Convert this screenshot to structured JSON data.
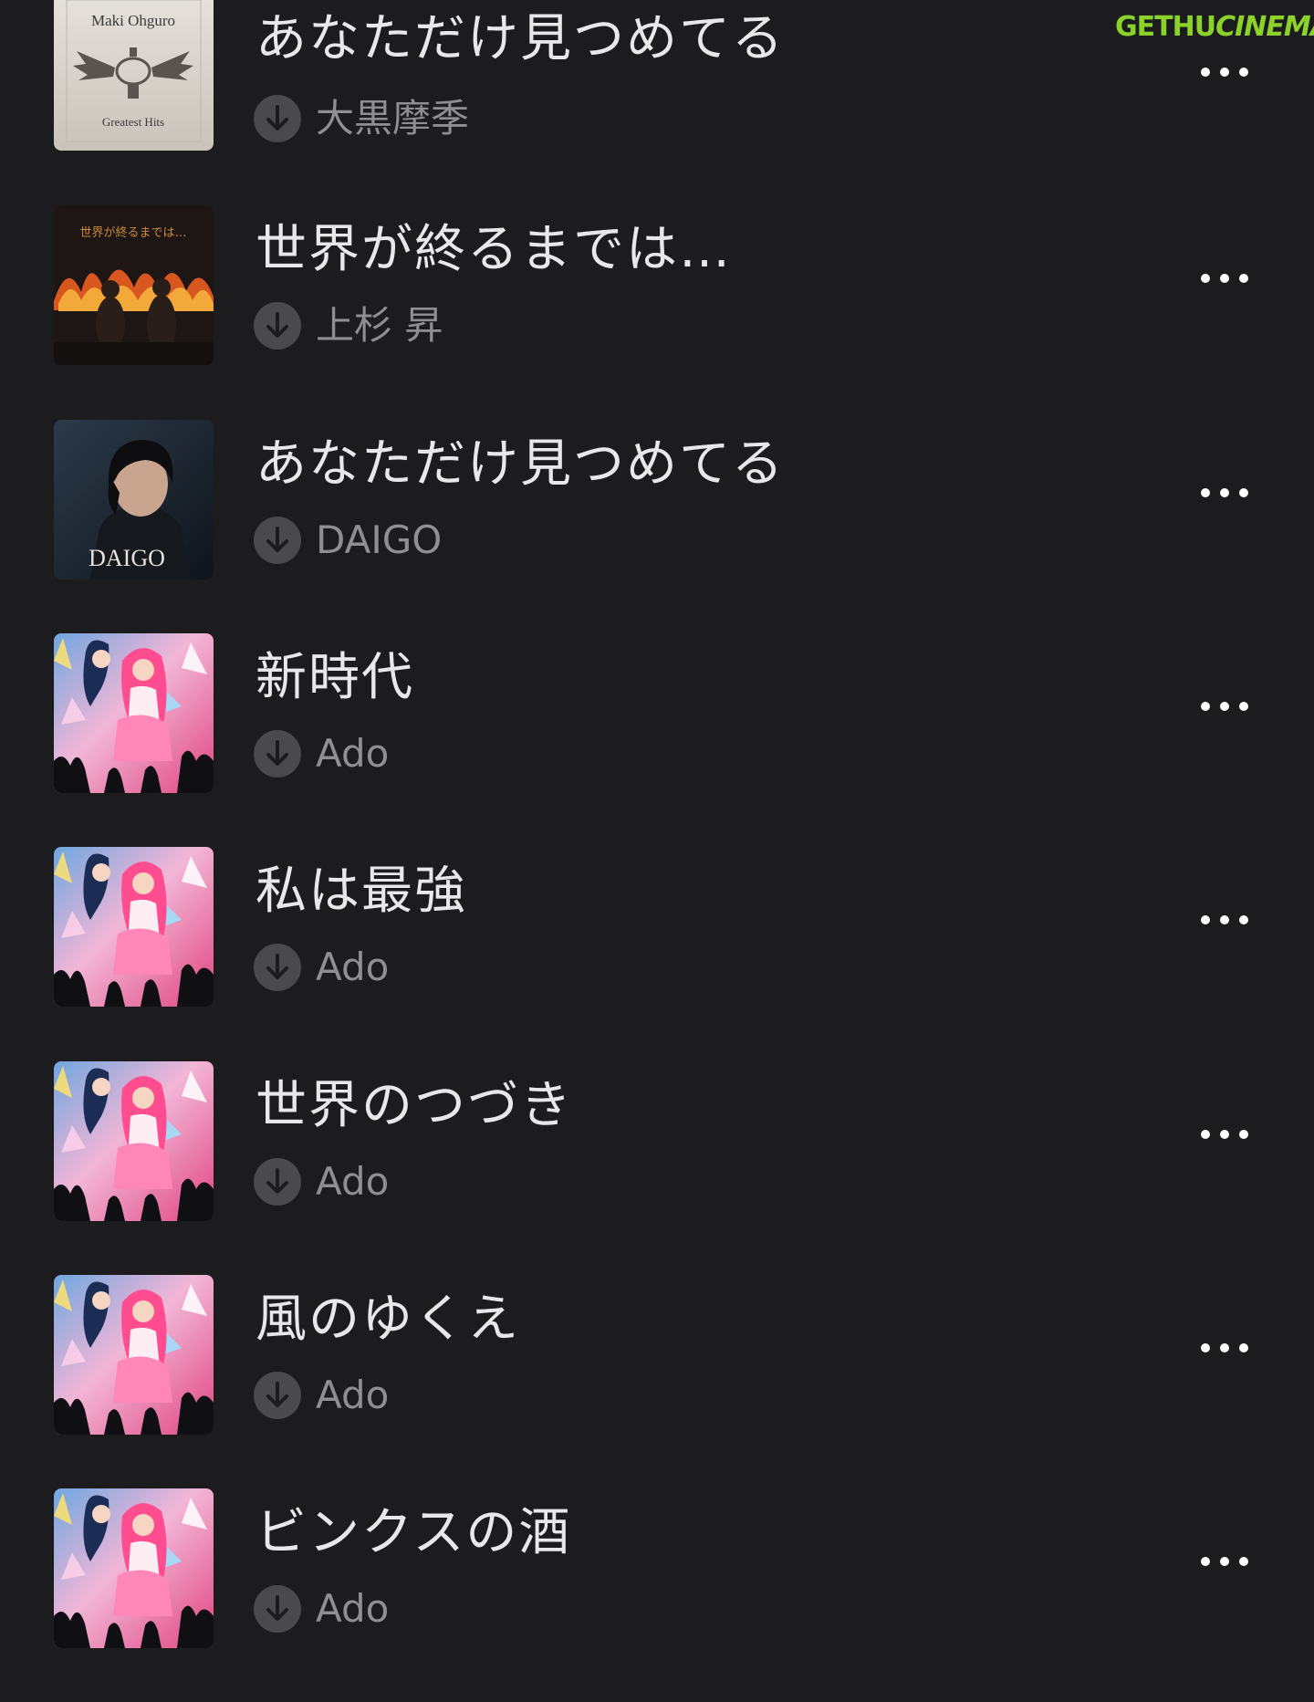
{
  "watermark": {
    "part1": "GETHU",
    "part2": "CINEMA"
  },
  "songs": [
    {
      "title": "あなただけ見つめてる",
      "artist": "大黒摩季",
      "artwork": "maki-ohguro-greatest-hits",
      "artwork_text": [
        "Maki Ohguro",
        "Greatest Hits"
      ]
    },
    {
      "title": "世界が終るまでは…",
      "artist": "上杉 昇",
      "artwork": "sekai-ga-owaru-made-wa",
      "artwork_text": [
        "世界が終るまでは…"
      ]
    },
    {
      "title": "あなただけ見つめてる",
      "artist": "DAIGO",
      "artwork": "daigo-portrait",
      "artwork_text": [
        "DAIGO"
      ]
    },
    {
      "title": "新時代",
      "artist": "Ado",
      "artwork": "uta-no-uta-anime",
      "artwork_text": []
    },
    {
      "title": "私は最強",
      "artist": "Ado",
      "artwork": "uta-no-uta-anime",
      "artwork_text": []
    },
    {
      "title": "世界のつづき",
      "artist": "Ado",
      "artwork": "uta-no-uta-anime",
      "artwork_text": []
    },
    {
      "title": "風のゆくえ",
      "artist": "Ado",
      "artwork": "uta-no-uta-anime",
      "artwork_text": []
    },
    {
      "title": "ビンクスの酒",
      "artist": "Ado",
      "artwork": "uta-no-uta-anime",
      "artwork_text": []
    }
  ],
  "icons": {
    "download": "download-arrow-circle-icon",
    "more": "ellipsis-more-icon"
  },
  "colors": {
    "background": "#1c1c1e",
    "title": "#e8e8ea",
    "artist": "#8e8e93",
    "watermark": "#8bd22a"
  }
}
